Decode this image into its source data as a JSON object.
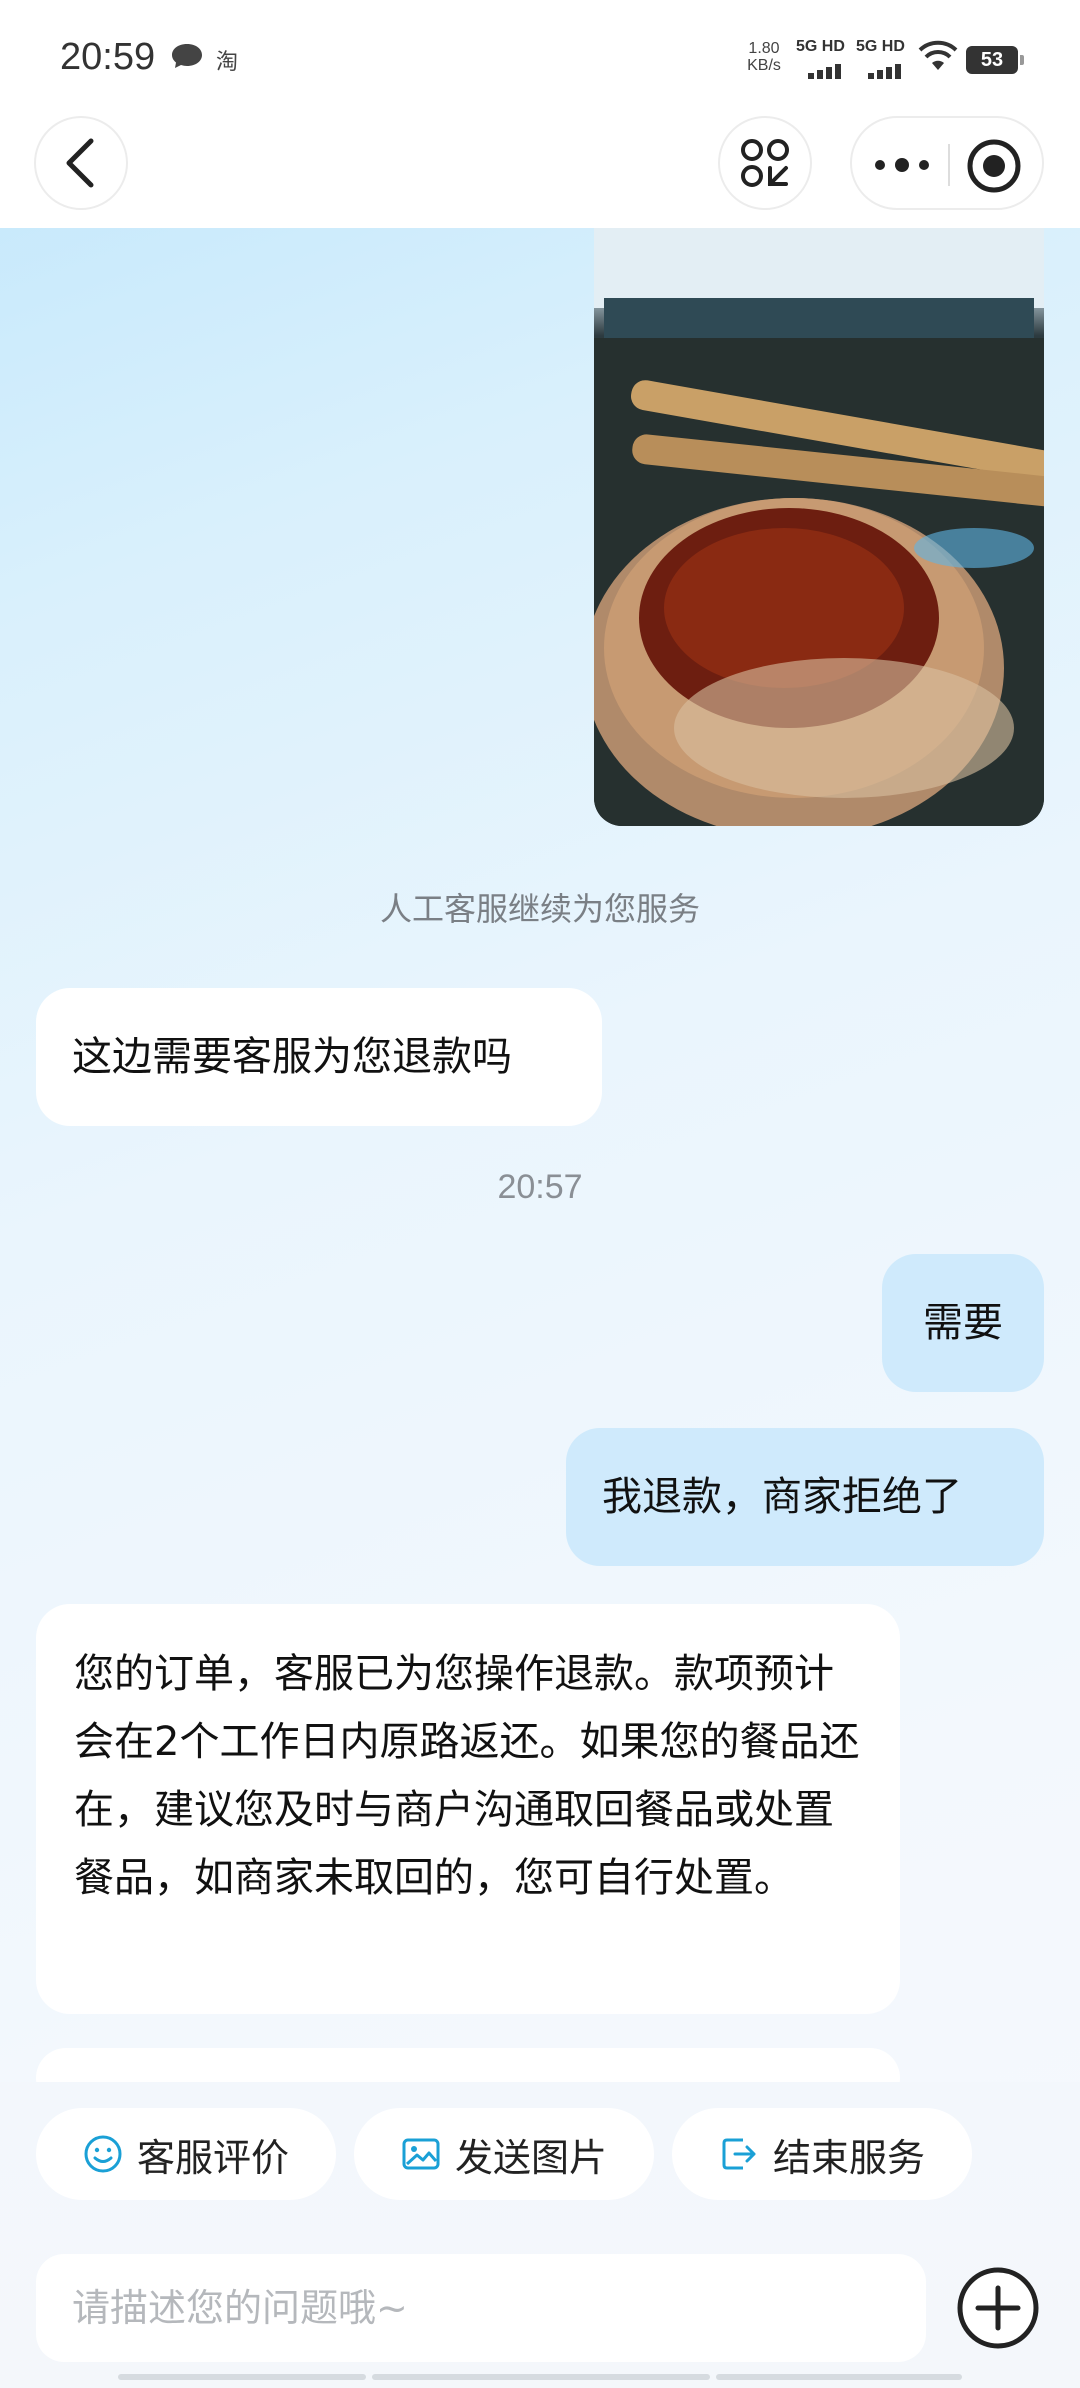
{
  "status_bar": {
    "time": "20:59",
    "app_badge": "淘",
    "net_speed_value": "1.80",
    "net_speed_unit": "KB/s",
    "sim1_label": "5G HD",
    "sim2_label": "5G HD",
    "battery": "53"
  },
  "nav": {
    "back_icon": "chevron-left-icon",
    "scan_icon": "scan-icon",
    "more_icon": "more-dots-icon",
    "close_icon": "target-icon"
  },
  "chat": {
    "system_notice": "人工客服继续为您服务",
    "messages": [
      {
        "side": "left",
        "text": "这边需要客服为您退款吗"
      },
      {
        "side": "right",
        "text": "需要"
      },
      {
        "side": "right",
        "text": "我退款，商家拒绝了"
      },
      {
        "side": "left",
        "text": "您的订单，客服已为您操作退款。款项预计会在2个工作日内原路返还。如果您的餐品还在，建议您及时与商户沟通取回餐品或处置餐品，如商家未取回的，您可自行处置。"
      }
    ],
    "timestamp": "20:57"
  },
  "quick_actions": [
    {
      "label": "客服评价",
      "icon": "smile-icon"
    },
    {
      "label": "发送图片",
      "icon": "image-icon"
    },
    {
      "label": "结束服务",
      "icon": "exit-icon"
    }
  ],
  "composer": {
    "placeholder": "请描述您的问题哦~"
  },
  "colors": {
    "accent": "#1aa0d6",
    "user_bubble": "#cfeafc",
    "agent_bubble": "#ffffff"
  }
}
